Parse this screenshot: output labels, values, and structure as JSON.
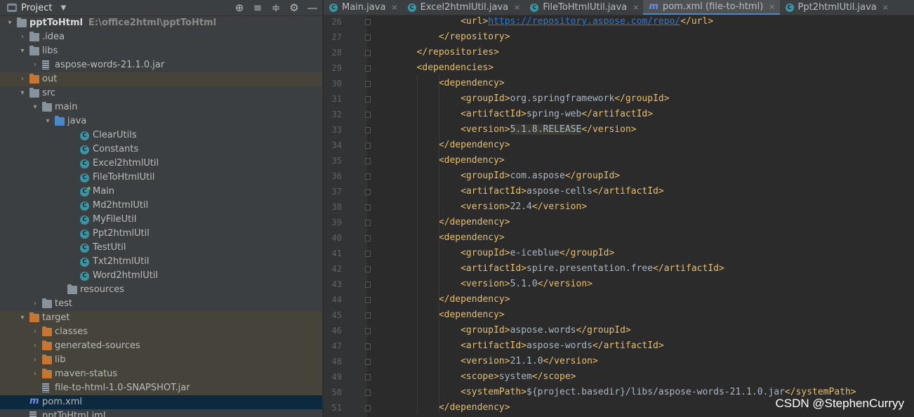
{
  "project_panel": {
    "title": "Project",
    "dropdown": "▼",
    "tools": [
      "⊕",
      "≡",
      "≑",
      "⚙",
      "—"
    ],
    "tree": [
      {
        "depth": 0,
        "arrow": "▾",
        "icon": "module",
        "label": "pptToHtml",
        "path": "E:\\office2html\\pptToHtml",
        "bold": true
      },
      {
        "depth": 1,
        "arrow": "›",
        "icon": "folder",
        "label": ".idea"
      },
      {
        "depth": 1,
        "arrow": "▾",
        "icon": "folder",
        "label": "libs"
      },
      {
        "depth": 2,
        "arrow": "›",
        "icon": "jar",
        "label": "aspose-words-21.1.0.jar"
      },
      {
        "depth": 1,
        "arrow": "›",
        "icon": "folder-orange",
        "label": "out",
        "hl": true
      },
      {
        "depth": 1,
        "arrow": "▾",
        "icon": "folder",
        "label": "src"
      },
      {
        "depth": 2,
        "arrow": "▾",
        "icon": "folder",
        "label": "main"
      },
      {
        "depth": 3,
        "arrow": "▾",
        "icon": "folder-blue",
        "label": "java"
      },
      {
        "depth": 5,
        "arrow": "",
        "icon": "class",
        "label": "ClearUtils"
      },
      {
        "depth": 5,
        "arrow": "",
        "icon": "class",
        "label": "Constants"
      },
      {
        "depth": 5,
        "arrow": "",
        "icon": "class",
        "label": "Excel2htmlUtil"
      },
      {
        "depth": 5,
        "arrow": "",
        "icon": "class",
        "label": "FileToHtmlUtil"
      },
      {
        "depth": 5,
        "arrow": "",
        "icon": "class-main",
        "label": "Main"
      },
      {
        "depth": 5,
        "arrow": "",
        "icon": "class",
        "label": "Md2htmlUtil"
      },
      {
        "depth": 5,
        "arrow": "",
        "icon": "class",
        "label": "MyFileUtil"
      },
      {
        "depth": 5,
        "arrow": "",
        "icon": "class",
        "label": "Ppt2htmlUtil"
      },
      {
        "depth": 5,
        "arrow": "",
        "icon": "class",
        "label": "TestUtil"
      },
      {
        "depth": 5,
        "arrow": "",
        "icon": "class",
        "label": "Txt2htmlUtil"
      },
      {
        "depth": 5,
        "arrow": "",
        "icon": "class",
        "label": "Word2htmlUtil"
      },
      {
        "depth": 4,
        "arrow": "",
        "icon": "folder-res",
        "label": "resources"
      },
      {
        "depth": 2,
        "arrow": "›",
        "icon": "folder",
        "label": "test"
      },
      {
        "depth": 1,
        "arrow": "▾",
        "icon": "folder-orange",
        "label": "target",
        "hl": true
      },
      {
        "depth": 2,
        "arrow": "›",
        "icon": "folder-orange",
        "label": "classes",
        "hl": true
      },
      {
        "depth": 2,
        "arrow": "›",
        "icon": "folder-orange",
        "label": "generated-sources",
        "hl": true
      },
      {
        "depth": 2,
        "arrow": "›",
        "icon": "folder-orange",
        "label": "lib",
        "hl": true
      },
      {
        "depth": 2,
        "arrow": "›",
        "icon": "folder-orange",
        "label": "maven-status",
        "hl": true
      },
      {
        "depth": 2,
        "arrow": "",
        "icon": "jar",
        "label": "file-to-html-1.0-SNAPSHOT.jar",
        "hl": true
      },
      {
        "depth": 1,
        "arrow": "",
        "icon": "maven",
        "label": "pom.xml",
        "sel": true
      },
      {
        "depth": 1,
        "arrow": "",
        "icon": "file",
        "label": "pptToHtml.iml"
      }
    ]
  },
  "tabs": [
    {
      "icon": "class-main",
      "label": "Main.java",
      "close": "×"
    },
    {
      "icon": "class",
      "label": "Excel2htmlUtil.java",
      "close": "×"
    },
    {
      "icon": "class",
      "label": "FileToHtmlUtil.java",
      "close": "×"
    },
    {
      "icon": "maven",
      "label": "pom.xml (file-to-html)",
      "close": "×",
      "active": true
    },
    {
      "icon": "class",
      "label": "Ppt2htmlUtil.java",
      "close": "×"
    }
  ],
  "code_lines": [
    {
      "n": "26",
      "indent": 4,
      "parts": [
        [
          "tag",
          "<url>"
        ],
        [
          "url",
          "https://repository.aspose.com/repo/"
        ],
        [
          "tag",
          "</url>"
        ]
      ]
    },
    {
      "n": "27",
      "indent": 3,
      "parts": [
        [
          "tag",
          "</repository>"
        ]
      ]
    },
    {
      "n": "28",
      "indent": 2,
      "parts": [
        [
          "tag",
          "</repositories>"
        ]
      ]
    },
    {
      "n": "29",
      "indent": 2,
      "parts": [
        [
          "tag",
          "<dependencies>"
        ]
      ]
    },
    {
      "n": "30",
      "indent": 3,
      "parts": [
        [
          "tag",
          "<dependency>"
        ]
      ]
    },
    {
      "n": "31",
      "indent": 4,
      "parts": [
        [
          "tag",
          "<groupId>"
        ],
        [
          "txt",
          "org.springframework"
        ],
        [
          "tag",
          "</groupId>"
        ]
      ]
    },
    {
      "n": "32",
      "indent": 4,
      "parts": [
        [
          "tag",
          "<artifactId>"
        ],
        [
          "txt",
          "spring-web"
        ],
        [
          "tag",
          "</artifactId>"
        ]
      ]
    },
    {
      "n": "33",
      "indent": 4,
      "parts": [
        [
          "tag",
          "<version>"
        ],
        [
          "hlv",
          "5.1.8.RELEASE"
        ],
        [
          "tag",
          "</version>"
        ]
      ]
    },
    {
      "n": "34",
      "indent": 3,
      "parts": [
        [
          "tag",
          "</dependency>"
        ]
      ]
    },
    {
      "n": "35",
      "indent": 3,
      "parts": [
        [
          "tag",
          "<dependency>"
        ]
      ]
    },
    {
      "n": "36",
      "indent": 4,
      "parts": [
        [
          "tag",
          "<groupId>"
        ],
        [
          "txt",
          "com.aspose"
        ],
        [
          "tag",
          "</groupId>"
        ]
      ]
    },
    {
      "n": "37",
      "indent": 4,
      "parts": [
        [
          "tag",
          "<artifactId>"
        ],
        [
          "txt",
          "aspose-cells"
        ],
        [
          "tag",
          "</artifactId>"
        ]
      ]
    },
    {
      "n": "38",
      "indent": 4,
      "parts": [
        [
          "tag",
          "<version>"
        ],
        [
          "txt",
          "22.4"
        ],
        [
          "tag",
          "</version>"
        ]
      ]
    },
    {
      "n": "39",
      "indent": 3,
      "parts": [
        [
          "tag",
          "</dependency>"
        ]
      ]
    },
    {
      "n": "40",
      "indent": 3,
      "parts": [
        [
          "tag",
          "<dependency>"
        ]
      ]
    },
    {
      "n": "41",
      "indent": 4,
      "parts": [
        [
          "tag",
          "<groupId>"
        ],
        [
          "txt",
          "e-iceblue"
        ],
        [
          "tag",
          "</groupId>"
        ]
      ]
    },
    {
      "n": "42",
      "indent": 4,
      "parts": [
        [
          "tag",
          "<artifactId>"
        ],
        [
          "txt",
          "spire.presentation.free"
        ],
        [
          "tag",
          "</artifactId>"
        ]
      ]
    },
    {
      "n": "43",
      "indent": 4,
      "parts": [
        [
          "tag",
          "<version>"
        ],
        [
          "txt",
          "5.1.0"
        ],
        [
          "tag",
          "</version>"
        ]
      ]
    },
    {
      "n": "44",
      "indent": 3,
      "parts": [
        [
          "tag",
          "</dependency>"
        ]
      ]
    },
    {
      "n": "45",
      "indent": 3,
      "parts": [
        [
          "tag",
          "<dependency>"
        ]
      ]
    },
    {
      "n": "46",
      "indent": 4,
      "parts": [
        [
          "tag",
          "<groupId>"
        ],
        [
          "txt",
          "aspose.words"
        ],
        [
          "tag",
          "</groupId>"
        ]
      ]
    },
    {
      "n": "47",
      "indent": 4,
      "parts": [
        [
          "tag",
          "<artifactId>"
        ],
        [
          "txt",
          "aspose-words"
        ],
        [
          "tag",
          "</artifactId>"
        ]
      ]
    },
    {
      "n": "48",
      "indent": 4,
      "parts": [
        [
          "tag",
          "<version>"
        ],
        [
          "txt",
          "21.1.0"
        ],
        [
          "tag",
          "</version>"
        ]
      ]
    },
    {
      "n": "49",
      "indent": 4,
      "parts": [
        [
          "tag",
          "<scope>"
        ],
        [
          "txt",
          "system"
        ],
        [
          "tag",
          "</scope>"
        ]
      ]
    },
    {
      "n": "50",
      "indent": 4,
      "parts": [
        [
          "tag",
          "<systemPath>"
        ],
        [
          "txt",
          "${project.basedir}/libs/aspose-words-21.1.0.jar"
        ],
        [
          "tag",
          "</systemPath>"
        ]
      ]
    },
    {
      "n": "51",
      "indent": 3,
      "parts": [
        [
          "tag",
          "</dependency>"
        ]
      ]
    }
  ],
  "watermark": "CSDN @StephenCurryy",
  "colors": {
    "tag": "#e8bf6a",
    "text": "#a9b7c6",
    "url": "#287bde",
    "selection": "#0d293e",
    "highlight": "#45433a"
  }
}
